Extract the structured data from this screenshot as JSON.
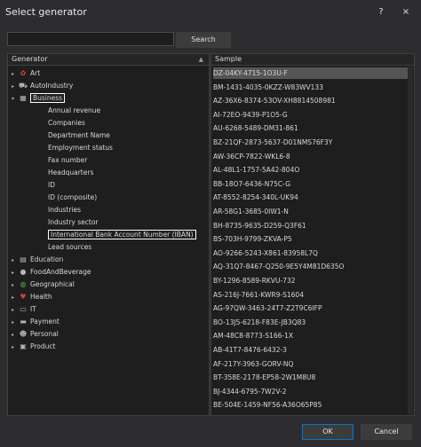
{
  "window": {
    "title": "Select generator",
    "help_label": "?",
    "close_label": "×"
  },
  "search": {
    "placeholder": "",
    "value": "",
    "button_label": "Search"
  },
  "tree": {
    "header": "Generator",
    "top_nodes": [
      {
        "label": "Art",
        "icon": "palette-icon",
        "color": "#d04040"
      },
      {
        "label": "AutoIndustry",
        "icon": "car-icon",
        "color": "#b5b5b5"
      },
      {
        "label": "Business",
        "icon": "building-icon",
        "color": "#b5b5b5"
      }
    ],
    "business_children": [
      "Annual revenue",
      "Companies",
      "Department Name",
      "Employment status",
      "Fax number",
      "Headquarters",
      "ID",
      "ID (composite)",
      "Industries",
      "Industry sector",
      "International Bank Account Number (IBAN)",
      "Lead sources"
    ],
    "bottom_nodes": [
      {
        "label": "Education",
        "icon": "education-icon",
        "color": "#b5b5b5"
      },
      {
        "label": "FoodAndBeverage",
        "icon": "food-icon",
        "color": "#b5b5b5"
      },
      {
        "label": "Geographical",
        "icon": "globe-icon",
        "color": "#4caf50"
      },
      {
        "label": "Health",
        "icon": "heart-icon",
        "color": "#d04040"
      },
      {
        "label": "IT",
        "icon": "computer-icon",
        "color": "#b5b5b5"
      },
      {
        "label": "Payment",
        "icon": "card-icon",
        "color": "#b5b5b5"
      },
      {
        "label": "Personal",
        "icon": "person-icon",
        "color": "#b5b5b5"
      },
      {
        "label": "Product",
        "icon": "box-icon",
        "color": "#b5b5b5"
      }
    ]
  },
  "samples": {
    "header": "Sample",
    "rows": [
      "DZ-04KY-4715-1O3U-F",
      "BM-1431-4035-0KZZ-W83WV133",
      "AZ-36X6-8374-53OV-XH8814508981",
      "AI-72EO-9439-P1O5-G",
      "AU-6268-5489-DM31-861",
      "BZ-21QF-2873-5637-D01NMS76F3Y",
      "AW-36CP-7822-WKL6-8",
      "AL-48L1-1757-5A42-804O",
      "BB-18O7-6436-N75C-G",
      "AT-8552-8254-340L-UK94",
      "AR-58G1-3685-0IW1-N",
      "BH-8735-9635-D259-Q3F61",
      "BS-703H-9799-ZKVA-P5",
      "AO-9266-5243-X861-83958L7Q",
      "AQ-31Q7-8467-Q250-9E5Y4M81D635O",
      "BY-1296-8589-RKVU-732",
      "AS-216J-7661-KWR9-S1604",
      "AG-97QW-3463-24T7-Z2T9C6IFP",
      "BO-13J5-6218-F83E-JB3Q83",
      "AM-48C8-8773-S166-1X",
      "AB-41T7-8476-6432-3",
      "AF-217Y-3963-GORV-NQ",
      "BT-358E-2178-EP58-2W1M8U8",
      "BJ-4344-6795-7W2V-2",
      "BE-504E-1459-NF56-A36O65P85"
    ],
    "selected_index": 0
  },
  "footer": {
    "ok_label": "OK",
    "cancel_label": "Cancel"
  }
}
